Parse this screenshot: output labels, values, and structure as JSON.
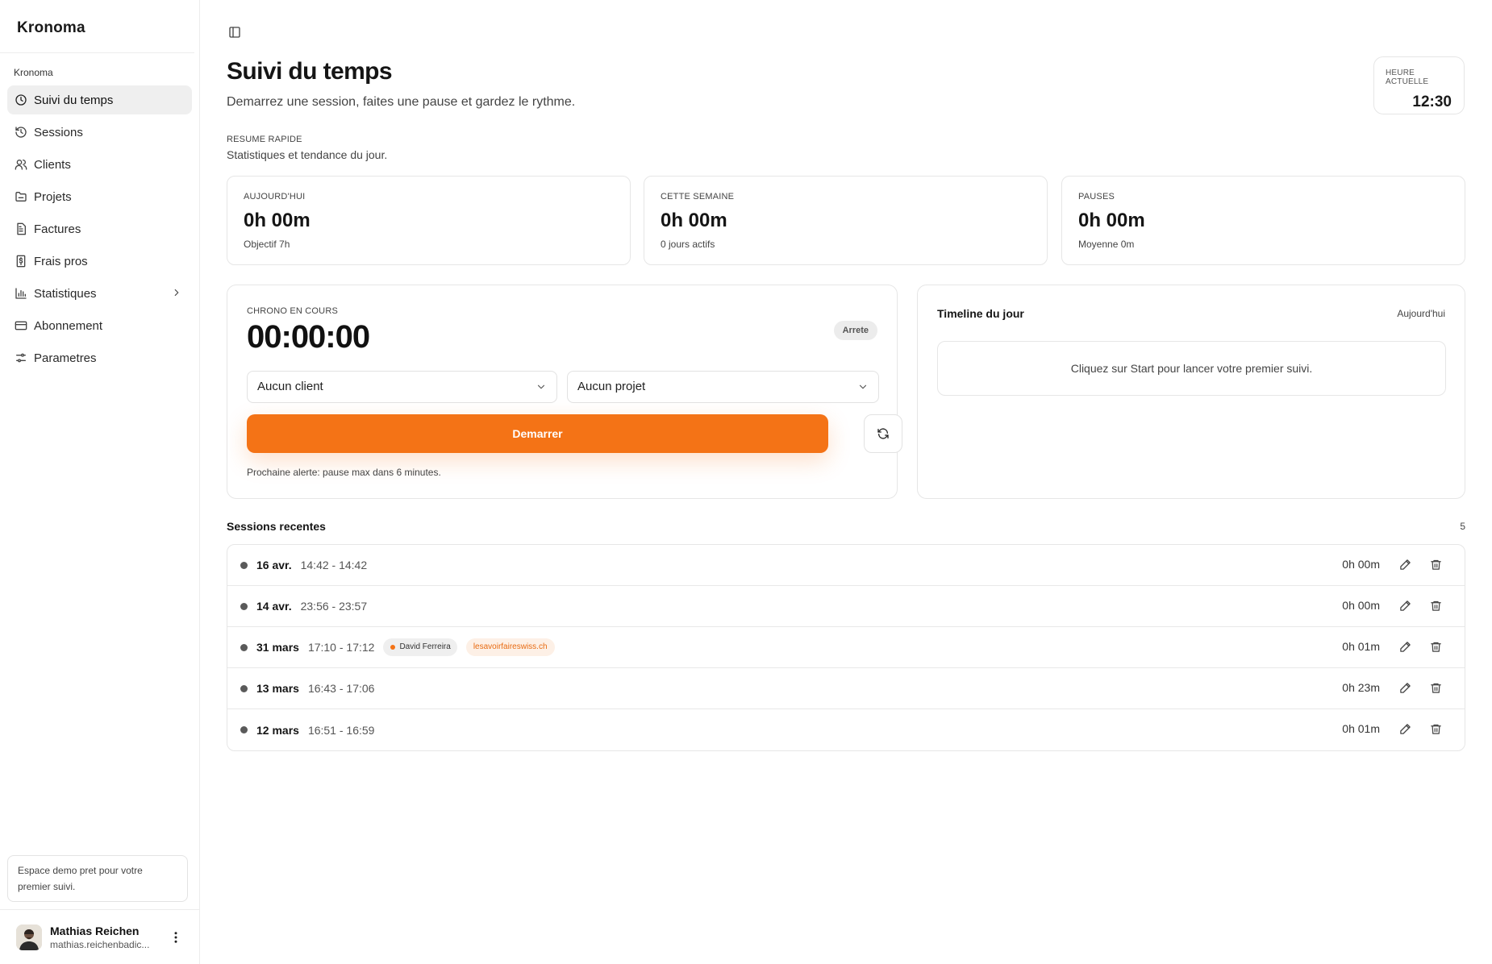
{
  "app": {
    "name": "Kronoma"
  },
  "sidebar": {
    "group_label": "Kronoma",
    "items": [
      {
        "label": "Suivi du temps",
        "icon": "clock-icon",
        "active": true
      },
      {
        "label": "Sessions",
        "icon": "history-icon"
      },
      {
        "label": "Clients",
        "icon": "users-icon"
      },
      {
        "label": "Projets",
        "icon": "folder-icon"
      },
      {
        "label": "Factures",
        "icon": "invoice-icon"
      },
      {
        "label": "Frais pros",
        "icon": "receipt-dollar-icon"
      },
      {
        "label": "Statistiques",
        "icon": "bar-chart-icon",
        "has_submenu": true
      },
      {
        "label": "Abonnement",
        "icon": "credit-card-icon"
      },
      {
        "label": "Parametres",
        "icon": "settings-sliders-icon"
      }
    ],
    "demo_note": "Espace demo pret pour votre premier suivi.",
    "user": {
      "name": "Mathias Reichen",
      "email": "mathias.reichenbadic..."
    }
  },
  "header": {
    "title": "Suivi du temps",
    "subtitle": "Demarrez une session, faites une pause et gardez le rythme.",
    "clock": {
      "label": "HEURE ACTUELLE",
      "value": "12:30"
    }
  },
  "summary": {
    "label": "RESUME RAPIDE",
    "subtitle": "Statistiques et tendance du jour.",
    "cards": [
      {
        "label": "AUJOURD'HUI",
        "value": "0h 00m",
        "note": "Objectif 7h"
      },
      {
        "label": "CETTE SEMAINE",
        "value": "0h 00m",
        "note": "0 jours actifs"
      },
      {
        "label": "PAUSES",
        "value": "0h 00m",
        "note": "Moyenne 0m"
      }
    ]
  },
  "timer": {
    "label": "CHRONO EN COURS",
    "value": "00:00:00",
    "status": "Arrete",
    "client_select": "Aucun client",
    "project_select": "Aucun projet",
    "start_label": "Demarrer",
    "note": "Prochaine alerte: pause max dans 6 minutes.",
    "accent_color": "#f47316"
  },
  "timeline": {
    "title": "Timeline du jour",
    "range": "Aujourd'hui",
    "empty": "Cliquez sur Start pour lancer votre premier suivi."
  },
  "recent": {
    "title": "Sessions recentes",
    "count": "5",
    "rows": [
      {
        "date": "16 avr.",
        "time": "14:42 - 14:42",
        "duration": "0h 00m"
      },
      {
        "date": "14 avr.",
        "time": "23:56 - 23:57",
        "duration": "0h 00m"
      },
      {
        "date": "31 mars",
        "time": "17:10 - 17:12",
        "client": "David Ferreira",
        "project": "lesavoirfaireswiss.ch",
        "duration": "0h 01m"
      },
      {
        "date": "13 mars",
        "time": "16:43 - 17:06",
        "duration": "0h 23m"
      },
      {
        "date": "12 mars",
        "time": "16:51 - 16:59",
        "duration": "0h 01m"
      }
    ]
  }
}
